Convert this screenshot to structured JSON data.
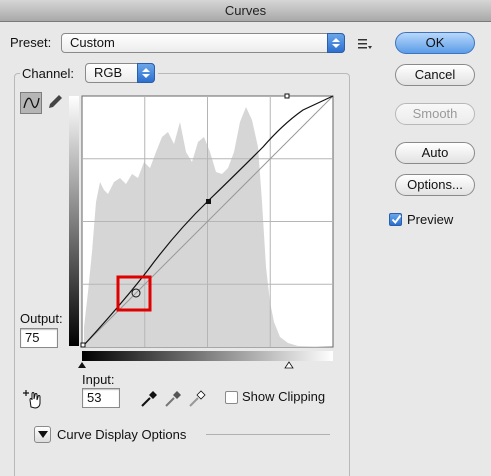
{
  "window": {
    "title": "Curves"
  },
  "preset": {
    "label": "Preset:",
    "value": "Custom"
  },
  "channel": {
    "label": "Channel:",
    "value": "RGB"
  },
  "buttons": {
    "ok": "OK",
    "cancel": "Cancel",
    "smooth": "Smooth",
    "auto": "Auto",
    "options": "Options..."
  },
  "preview": {
    "label": "Preview",
    "checked": true
  },
  "output": {
    "label": "Output:",
    "value": "75"
  },
  "input": {
    "label": "Input:",
    "value": "53"
  },
  "show_clipping": {
    "label": "Show Clipping",
    "checked": false
  },
  "curve_display_options": {
    "label": "Curve Display Options"
  },
  "colors": {
    "accent": "#2d6fcf",
    "highlight": "#e00000"
  },
  "icons": [
    "stepper-icon",
    "list-icon",
    "curve-tool-icon",
    "pencil-icon",
    "hand-adjust-icon",
    "eyedropper-black-icon",
    "eyedropper-gray-icon",
    "eyedropper-white-icon",
    "disclosure-icon",
    "checkmark-icon"
  ]
}
